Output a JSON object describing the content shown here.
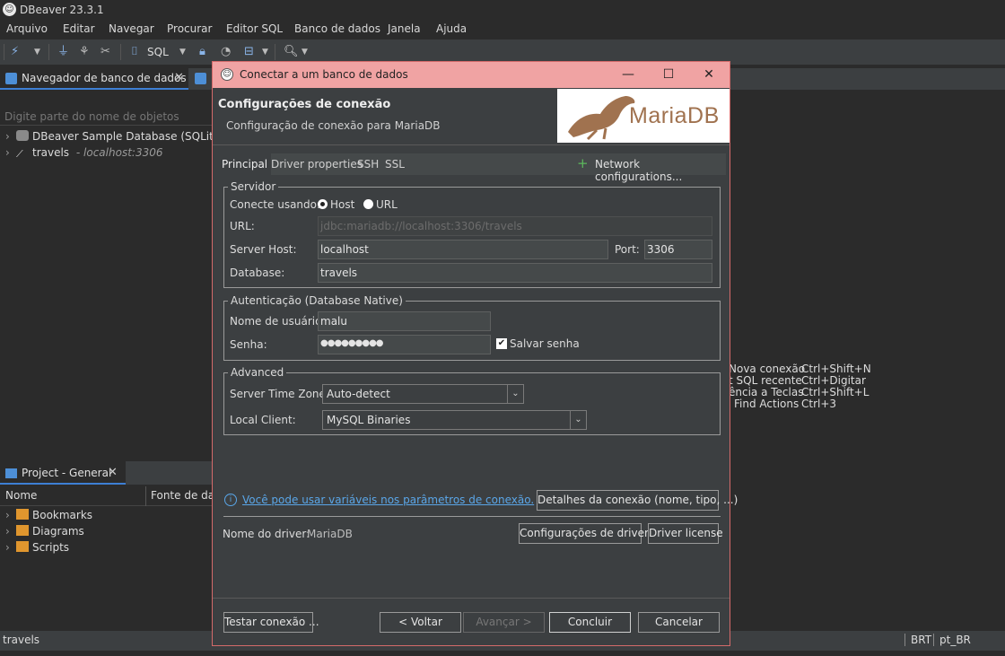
{
  "app": {
    "title": "DBeaver 23.3.1"
  },
  "menu": [
    "Arquivo",
    "Editar",
    "Navegar",
    "Procurar",
    "Editor SQL",
    "Banco de dados",
    "Janela",
    "Ajuda"
  ],
  "toolbar": {
    "sql_label": "SQL"
  },
  "navigator": {
    "tab_label": "Navegador de banco de dados",
    "filter_placeholder": "Digite parte do nome de objetos",
    "items": [
      {
        "label": "DBeaver Sample Database (SQLite)",
        "sub": ""
      },
      {
        "label": "travels",
        "sub": "- localhost:3306"
      }
    ]
  },
  "project": {
    "tab_label": "Project - General",
    "col_name": "Nome",
    "col_source": "Fonte de dados",
    "items": [
      "Bookmarks",
      "Diagrams",
      "Scripts"
    ]
  },
  "shortcuts": [
    {
      "label": "Nova conexão",
      "keys": "Ctrl+Shift+N"
    },
    {
      "label": "t SQL recente",
      "keys": "Ctrl+Digitar"
    },
    {
      "label": "ência a Teclas",
      "keys": "Ctrl+Shift+L"
    },
    {
      "label": "Find Actions",
      "keys": "Ctrl+3"
    }
  ],
  "status": {
    "left": "travels",
    "tz": "BRT",
    "locale": "pt_BR"
  },
  "dialog": {
    "title": "Conectar a um banco de dados",
    "header_title": "Configurações de conexão",
    "header_subtitle": "Configuração de conexão para MariaDB",
    "logo_text": "MariaDB",
    "tabs": [
      "Principal",
      "Driver properties",
      "SSH",
      "SSL"
    ],
    "network_config": "Network configurations...",
    "server": {
      "group": "Servidor",
      "connect_using": "Conecte usando:",
      "opt_host": "Host",
      "opt_url": "URL",
      "url_label": "URL:",
      "url_value": "jdbc:mariadb://localhost:3306/travels",
      "host_label": "Server Host:",
      "host_value": "localhost",
      "port_label": "Port:",
      "port_value": "3306",
      "db_label": "Database:",
      "db_value": "travels"
    },
    "auth": {
      "group": "Autenticação (Database Native)",
      "user_label": "Nome de usuário:",
      "user_value": "malu",
      "pass_label": "Senha:",
      "pass_value": "●●●●●●●●●",
      "save_label": "Salvar senha"
    },
    "advanced": {
      "group": "Advanced",
      "tz_label": "Server Time Zone:",
      "tz_value": "Auto-detect",
      "client_label": "Local Client:",
      "client_value": "MySQL Binaries"
    },
    "vars_link": "Você pode usar variáveis nos parâmetros de conexão.",
    "details_button": "Detalhes da conexão (nome, tipo, ...)",
    "driver_label": "Nome do driver:",
    "driver_value": "MariaDB",
    "driver_settings_button": "Configurações de driver",
    "driver_license_button": "Driver license",
    "test_button": "Testar conexão ...",
    "back_button": "< Voltar",
    "next_button": "Avançar >",
    "finish_button": "Concluir",
    "cancel_button": "Cancelar"
  }
}
